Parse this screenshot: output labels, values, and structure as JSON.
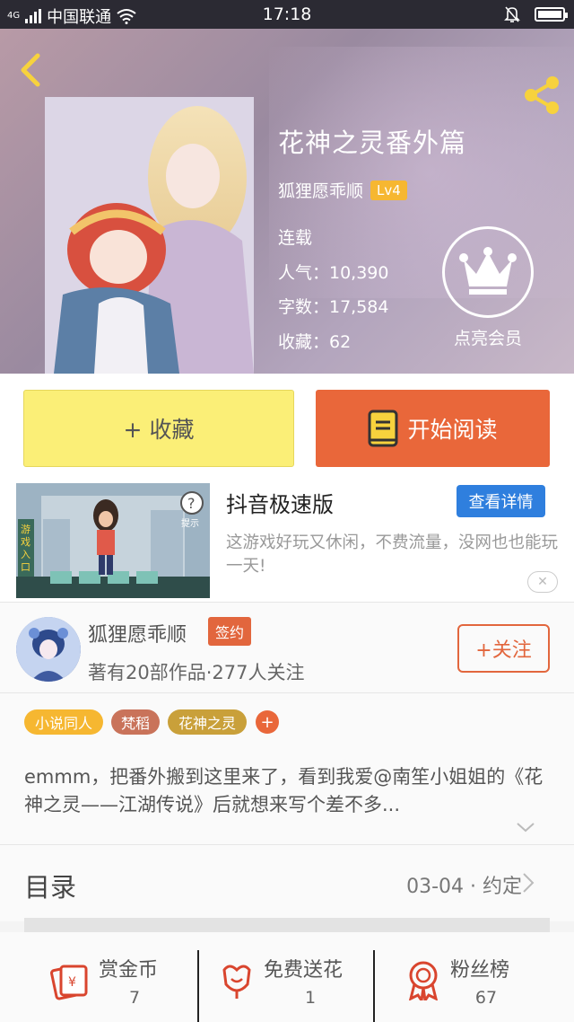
{
  "status_bar": {
    "network": "4G",
    "carrier": "中国联通",
    "time": "17:18"
  },
  "header": {
    "title": "花神之灵番外篇",
    "author": "狐狸愿乖顺",
    "level": "Lv4",
    "status": "连载",
    "popularity": "人气：10,390",
    "word_count": "字数：17,584",
    "favorites": "收藏：62",
    "vip_label": "点亮会员",
    "icons": {
      "back": "back-chevron-icon",
      "share": "share-icon",
      "vip": "crown-icon"
    }
  },
  "actions": {
    "favorite_label": "+ 收藏",
    "read_label": "开始阅读",
    "colors": {
      "favorite_bg": "#fbef77",
      "read_bg": "#e9673a"
    }
  },
  "ad": {
    "title": "抖音极速版",
    "detail_button": "查看详情",
    "description": "这游戏好玩又休闲，不费流量，没网也也能玩一天!",
    "image_text": "游戏入口",
    "hint_label": "提示",
    "close_label": "✕"
  },
  "author_card": {
    "name": "狐狸愿乖顺",
    "badge": "签约",
    "summary": "著有20部作品·277人关注",
    "follow_label": "+关注"
  },
  "tags": [
    {
      "label": "小说同人",
      "color": "#f6b731"
    },
    {
      "label": "梵稻",
      "color": "#c9735a"
    },
    {
      "label": "花神之灵",
      "color": "#c9a03a"
    }
  ],
  "tag_add_label": "+",
  "description": "emmm，把番外搬到这里来了，看到我爱@南笙小姐姐的《花神之灵——江湖传说》后就想来写个差不多...",
  "catalog": {
    "title": "目录",
    "meta": "03-04 · 约定"
  },
  "stats": [
    {
      "label": "赏金币",
      "value": "7",
      "icon": "coin-envelope-icon"
    },
    {
      "label": "免费送花",
      "value": "1",
      "icon": "flower-icon"
    },
    {
      "label": "粉丝榜",
      "value": "67",
      "icon": "ribbon-medal-icon"
    }
  ],
  "accent_color": "#e2663d"
}
